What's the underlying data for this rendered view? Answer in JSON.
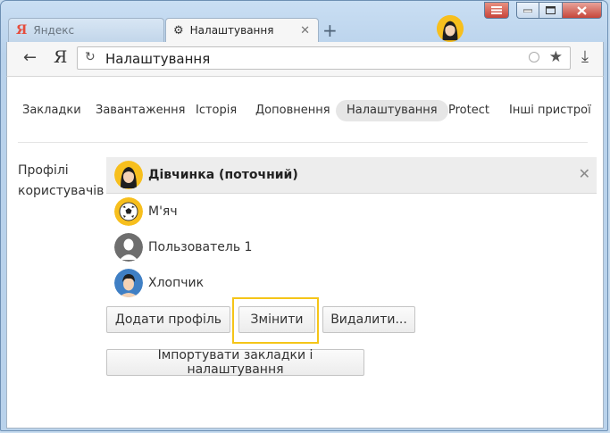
{
  "window": {
    "controls": [
      "menu-icon",
      "minimize-icon",
      "maximize-icon",
      "close-icon"
    ]
  },
  "tabs": [
    {
      "label": "Яндекс",
      "icon": "yandex-icon",
      "active": false
    },
    {
      "label": "Налаштування",
      "icon": "gear-icon",
      "active": true
    }
  ],
  "toolbar": {
    "yandex_button": "Я",
    "address": "Налаштування"
  },
  "nav": {
    "items": [
      {
        "label": "Закладки"
      },
      {
        "label": "Завантаження"
      },
      {
        "label": "Історія"
      },
      {
        "label": "Доповнення"
      },
      {
        "label": "Налаштування"
      },
      {
        "label": "Protect"
      },
      {
        "label": "Інші пристрої"
      }
    ],
    "active_index": 4
  },
  "profiles_section": {
    "label_line1": "Профілі",
    "label_line2": "користувачів",
    "profiles": [
      {
        "name": "Дівчинка (поточний)",
        "avatar": "girl-avatar",
        "current": true
      },
      {
        "name": "М'яч",
        "avatar": "ball-avatar",
        "current": false
      },
      {
        "name": "Пользователь 1",
        "avatar": "default-user-avatar",
        "current": false
      },
      {
        "name": "Хлопчик",
        "avatar": "boy-avatar",
        "current": false
      }
    ],
    "buttons": {
      "add": "Додати профіль",
      "edit": "Змінити",
      "delete": "Видалити...",
      "import": "Імпортувати закладки і налаштування"
    }
  },
  "colors": {
    "highlight": "#f5c518",
    "avatar_yellow": "#f7bf1d",
    "boy_blue": "#3f7fc4",
    "default_grey": "#6e6e6e"
  }
}
